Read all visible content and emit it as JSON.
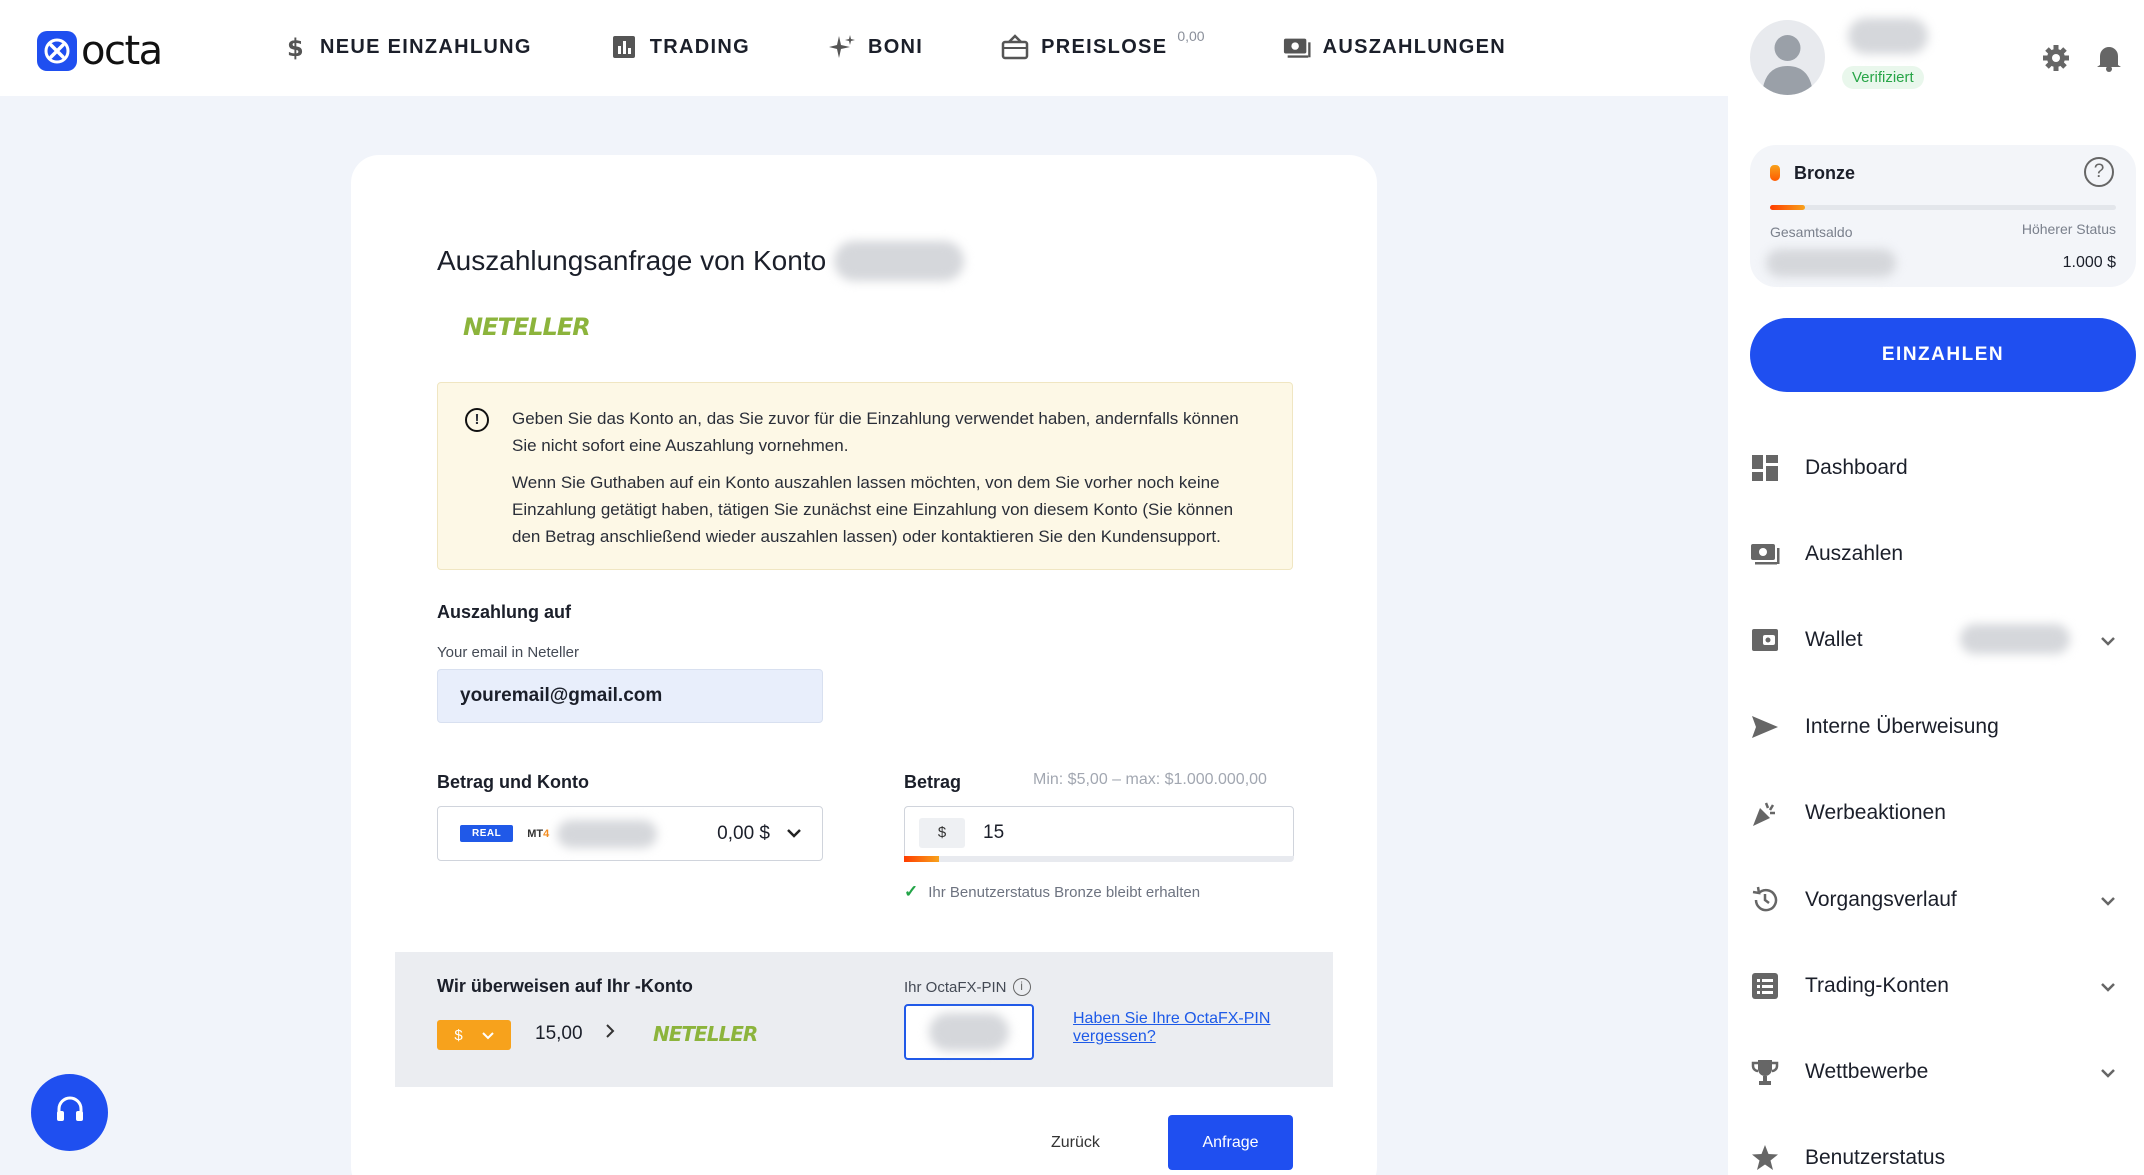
{
  "header": {
    "logo_text": "octa",
    "nav": [
      {
        "label": "NEUE EINZAHLUNG",
        "icon": "dollar-icon"
      },
      {
        "label": "TRADING",
        "icon": "chart-bars-icon"
      },
      {
        "label": "BONI",
        "icon": "sparkle-icon"
      },
      {
        "label": "PREISLOSE",
        "icon": "ticket-icon",
        "badge": "0,00"
      },
      {
        "label": "AUSZAHLUNGEN",
        "icon": "cash-icon"
      }
    ]
  },
  "form": {
    "title": "Auszahlungsanfrage von Konto",
    "payment_system": "NETELLER",
    "warning": {
      "p1": "Geben Sie das Konto an, das Sie zuvor für die Einzahlung verwendet haben, andernfalls können Sie nicht sofort eine Auszahlung vornehmen.",
      "p2": "Wenn Sie Guthaben auf ein Konto auszahlen lassen möchten, von dem Sie vorher noch keine Einzahlung getätigt haben, tätigen Sie zunächst eine Einzahlung von diesem Konto (Sie können den Betrag anschließend wieder auszahlen lassen) oder kontaktieren Sie den Kundensupport."
    },
    "payout_to_label": "Auszahlung auf",
    "email_label": "Your email in Neteller",
    "email_value": "youremail@gmail.com",
    "amount_account_label": "Betrag und Konto",
    "account": {
      "type_badge": "REAL",
      "platform": "MT",
      "platform_num": "4",
      "balance": "0,00 $"
    },
    "amount_label": "Betrag",
    "amount_limits": "Min: $5,00 – max: $1.000.000,00",
    "currency_symbol": "$",
    "amount_value": "15",
    "amount_progress": 0.09,
    "status_note": "Ihr Benutzerstatus Bronze bleibt erhalten",
    "transfer": {
      "title": "Wir überweisen auf Ihr -Konto",
      "currency": "$",
      "amount": "15,00",
      "pin_label": "Ihr OctaFX-PIN",
      "pin_forgot": "Haben Sie Ihre OctaFX-PIN vergessen?"
    },
    "back_label": "Zurück",
    "submit_label": "Anfrage"
  },
  "sidebar": {
    "verified_label": "Verifiziert",
    "status": {
      "name": "Bronze",
      "progress": 0.1,
      "total_label": "Gesamtsaldo",
      "next_label": "Höherer Status",
      "next_amount": "1.000 $"
    },
    "deposit_label": "EINZAHLEN",
    "menu": [
      {
        "label": "Dashboard",
        "icon": "dashboard-icon"
      },
      {
        "label": "Auszahlen",
        "icon": "withdraw-icon"
      },
      {
        "label": "Wallet",
        "icon": "wallet-icon"
      },
      {
        "label": "Interne Überweisung",
        "icon": "send-icon"
      },
      {
        "label": "Werbeaktionen",
        "icon": "party-icon"
      },
      {
        "label": "Vorgangsverlauf",
        "icon": "history-icon"
      },
      {
        "label": "Trading-Konten",
        "icon": "list-icon"
      },
      {
        "label": "Wettbewerbe",
        "icon": "trophy-icon"
      },
      {
        "label": "Benutzerstatus",
        "icon": "star-icon"
      }
    ]
  },
  "colors": {
    "accent": "#1f4ff0",
    "neteller_green": "#8cb43c",
    "warning_bg": "#fdf8e6",
    "orange": "#f7a21c"
  }
}
